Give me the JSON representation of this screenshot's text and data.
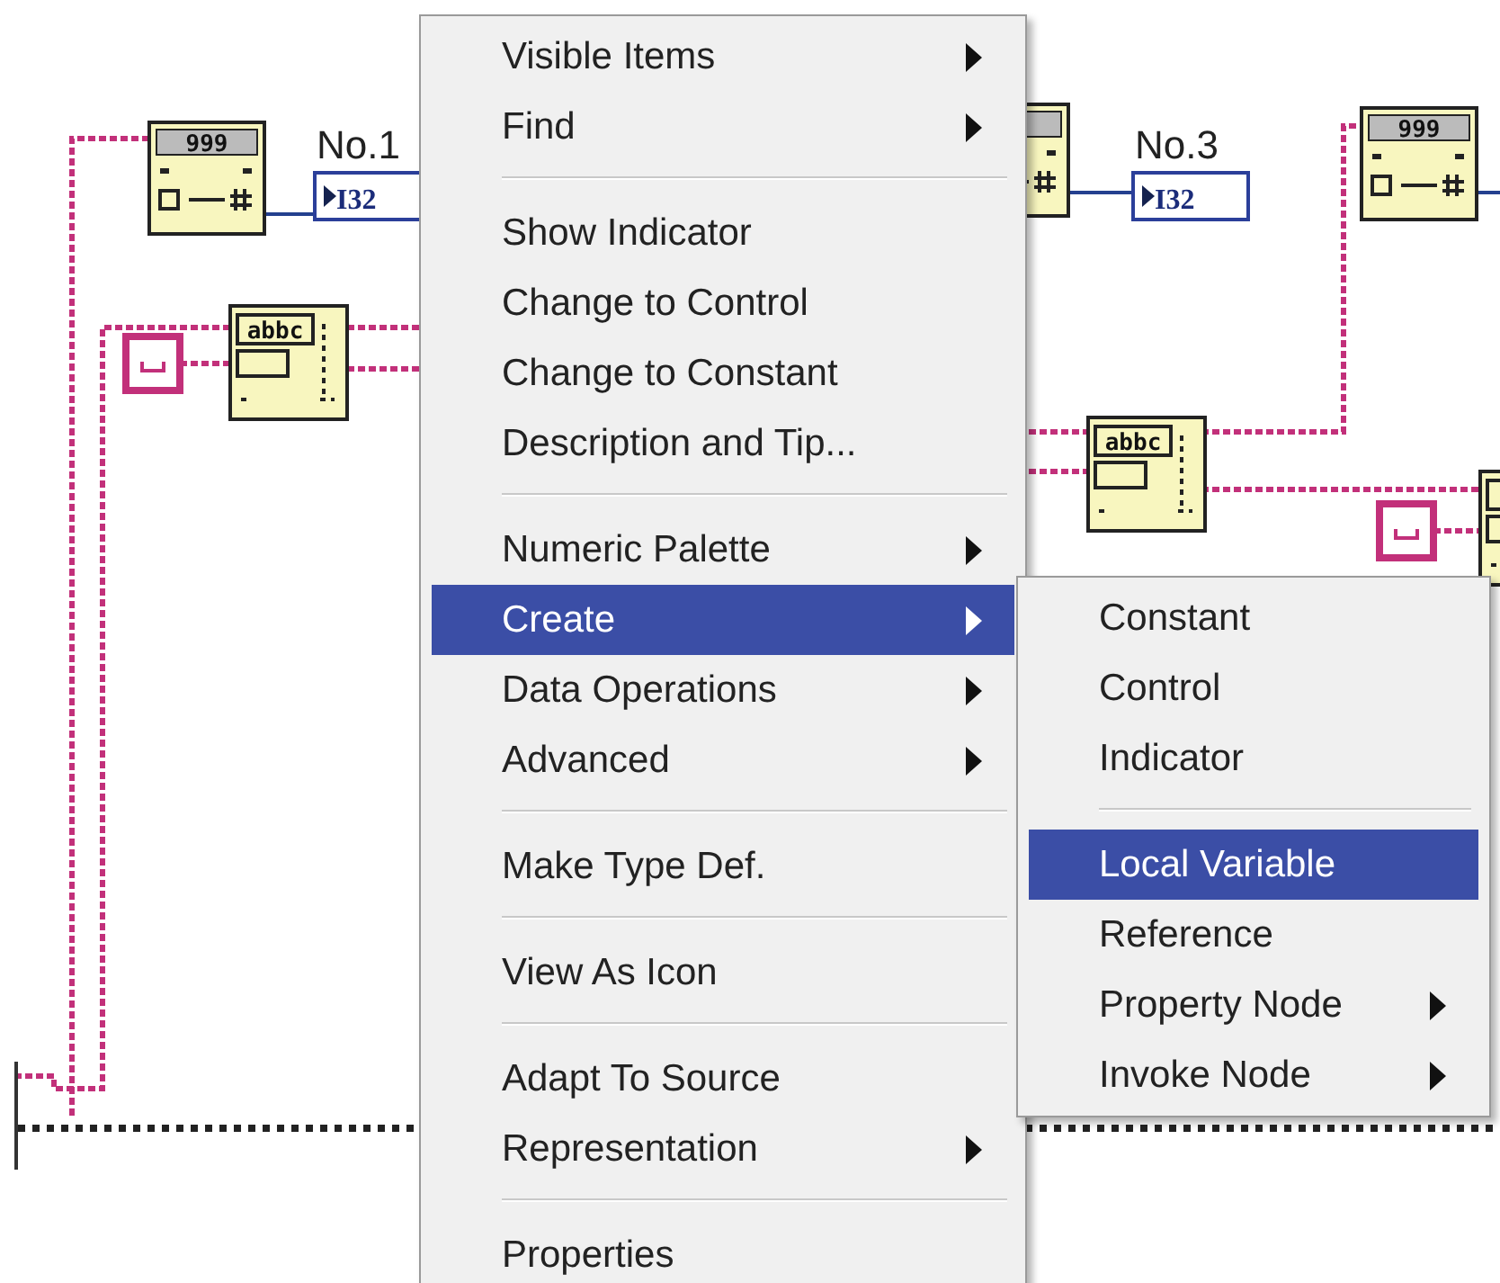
{
  "diagram": {
    "nodes": [
      {
        "kind": "format",
        "label": "999"
      },
      {
        "kind": "format"
      },
      {
        "kind": "format",
        "label": "999"
      },
      {
        "kind": "string",
        "label": "abbc"
      },
      {
        "kind": "string",
        "label": "abbc"
      },
      {
        "kind": "string"
      },
      {
        "kind": "space"
      },
      {
        "kind": "space"
      },
      {
        "kind": "indicator",
        "label": "I32",
        "caption": "No.1"
      },
      {
        "kind": "indicator",
        "label": "I32",
        "caption": "No.3"
      }
    ]
  },
  "menu": {
    "items": [
      {
        "kind": "item",
        "label": "Visible Items",
        "submenu": true,
        "selected": false
      },
      {
        "kind": "item",
        "label": "Find",
        "submenu": true,
        "selected": false
      },
      {
        "kind": "separator"
      },
      {
        "kind": "item",
        "label": "Show Indicator",
        "submenu": false,
        "selected": false
      },
      {
        "kind": "item",
        "label": "Change to Control",
        "submenu": false,
        "selected": false
      },
      {
        "kind": "item",
        "label": "Change to Constant",
        "submenu": false,
        "selected": false
      },
      {
        "kind": "item",
        "label": "Description and Tip...",
        "submenu": false,
        "selected": false
      },
      {
        "kind": "separator"
      },
      {
        "kind": "item",
        "label": "Numeric Palette",
        "submenu": true,
        "selected": false
      },
      {
        "kind": "item",
        "label": "Create",
        "submenu": true,
        "selected": true
      },
      {
        "kind": "item",
        "label": "Data Operations",
        "submenu": true,
        "selected": false
      },
      {
        "kind": "item",
        "label": "Advanced",
        "submenu": true,
        "selected": false
      },
      {
        "kind": "separator"
      },
      {
        "kind": "item",
        "label": "Make Type Def.",
        "submenu": false,
        "selected": false
      },
      {
        "kind": "separator"
      },
      {
        "kind": "item",
        "label": "View As Icon",
        "submenu": false,
        "selected": false
      },
      {
        "kind": "separator"
      },
      {
        "kind": "item",
        "label": "Adapt To Source",
        "submenu": false,
        "selected": false
      },
      {
        "kind": "item",
        "label": "Representation",
        "submenu": true,
        "selected": false
      },
      {
        "kind": "separator"
      },
      {
        "kind": "item",
        "label": "Properties",
        "submenu": false,
        "selected": false
      }
    ]
  },
  "submenu": {
    "items": [
      {
        "kind": "item",
        "label": "Constant",
        "submenu": false,
        "selected": false
      },
      {
        "kind": "item",
        "label": "Control",
        "submenu": false,
        "selected": false
      },
      {
        "kind": "item",
        "label": "Indicator",
        "submenu": false,
        "selected": false
      },
      {
        "kind": "separator"
      },
      {
        "kind": "item",
        "label": "Local Variable",
        "submenu": false,
        "selected": true
      },
      {
        "kind": "item",
        "label": "Reference",
        "submenu": false,
        "selected": false
      },
      {
        "kind": "item",
        "label": "Property Node",
        "submenu": true,
        "selected": false
      },
      {
        "kind": "item",
        "label": "Invoke Node",
        "submenu": true,
        "selected": false
      }
    ]
  }
}
